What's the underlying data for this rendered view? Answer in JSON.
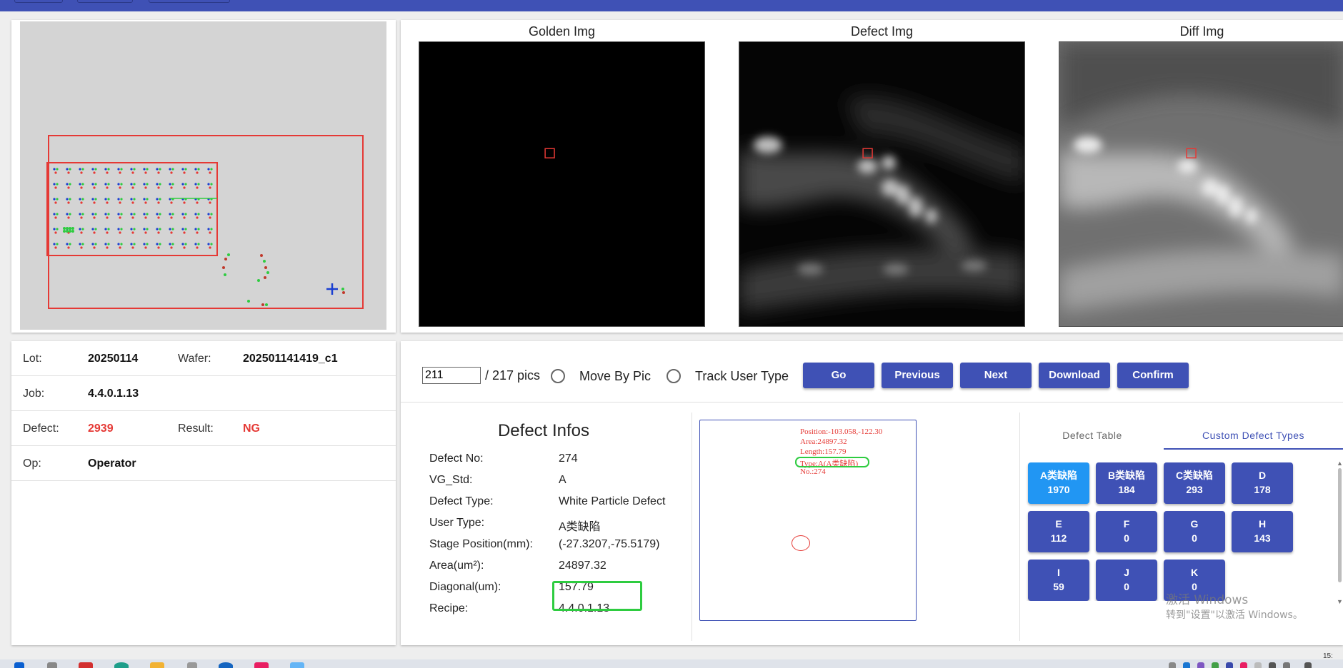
{
  "images": {
    "golden_title": "Golden Img",
    "defect_title": "Defect Img",
    "diff_title": "Diff Img"
  },
  "info": {
    "lot_label": "Lot:",
    "lot_value": "20250114",
    "wafer_label": "Wafer:",
    "wafer_value": "202501141419_c1",
    "job_label": "Job:",
    "job_value": "4.4.0.1.13",
    "defect_label": "Defect:",
    "defect_value": "2939",
    "result_label": "Result:",
    "result_value": "NG",
    "op_label": "Op:",
    "op_value": "Operator"
  },
  "controls": {
    "pic_index": "211",
    "pic_total": "/ 217 pics",
    "move_by_pic": "Move By Pic",
    "track_user_type": "Track User Type",
    "go": "Go",
    "previous": "Previous",
    "next": "Next",
    "download": "Download",
    "confirm": "Confirm"
  },
  "defect_infos": {
    "title": "Defect Infos",
    "rows": [
      {
        "k": "Defect No:",
        "v": "274"
      },
      {
        "k": "VG_Std:",
        "v": "A"
      },
      {
        "k": "Defect Type:",
        "v": "White Particle Defect"
      },
      {
        "k": "User Type:",
        "v": "A类缺陷"
      },
      {
        "k": "Stage Position(mm):",
        "v": "(-27.3207,-75.5179)"
      },
      {
        "k": "Area(um²):",
        "v": "24897.32"
      },
      {
        "k": "Diagonal(um):",
        "v": "157.79"
      },
      {
        "k": "Recipe:",
        "v": "4.4.0.1.13"
      }
    ]
  },
  "annotation": {
    "lines": [
      "Position:-103.058,-122.30",
      "Area:24897.32",
      "Length:157.79",
      "Type:A(A类缺陷)",
      "No.:274"
    ]
  },
  "tabs": {
    "defect_table": "Defect Table",
    "custom_defect_types": "Custom Defect Types"
  },
  "defect_types": [
    {
      "name": "A类缺陷",
      "count": "1970"
    },
    {
      "name": "B类缺陷",
      "count": "184"
    },
    {
      "name": "C类缺陷",
      "count": "293"
    },
    {
      "name": "D",
      "count": "178"
    },
    {
      "name": "E",
      "count": "112"
    },
    {
      "name": "F",
      "count": "0"
    },
    {
      "name": "G",
      "count": "0"
    },
    {
      "name": "H",
      "count": "143"
    },
    {
      "name": "I",
      "count": "59"
    },
    {
      "name": "J",
      "count": "0"
    },
    {
      "name": "K",
      "count": "0"
    }
  ],
  "watermark": {
    "line1": "激活 Windows",
    "line2": "转到\"设置\"以激活 Windows。"
  },
  "taskbar": {
    "clock": "15:"
  },
  "colors": {
    "primary": "#3f51b5",
    "active_tile": "#2196f3",
    "ng_red": "#e53935",
    "highlight_green": "#2ecc40"
  }
}
